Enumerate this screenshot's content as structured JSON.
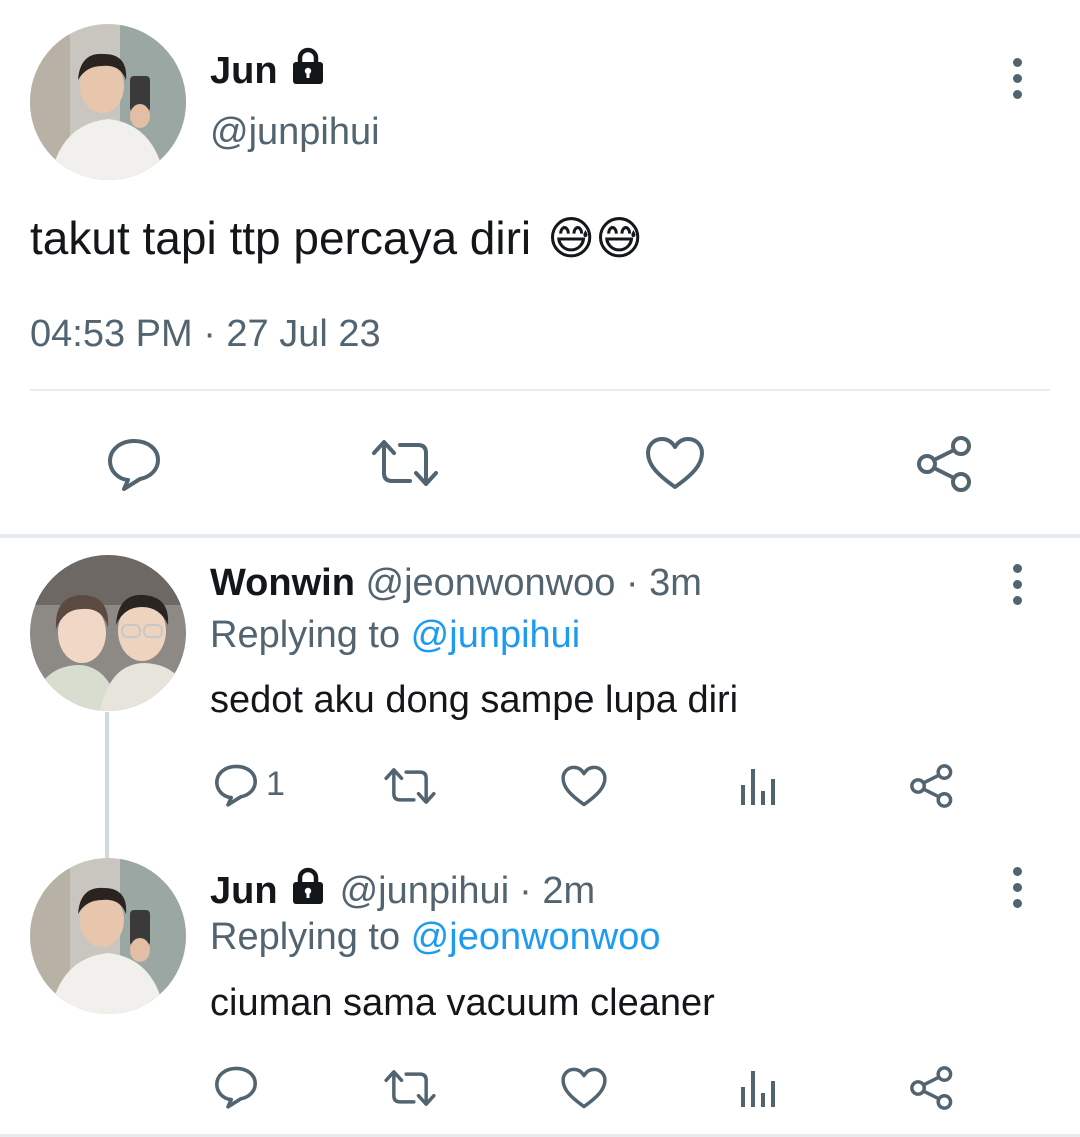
{
  "main_tweet": {
    "name": "Jun",
    "handle": "@junpihui",
    "text": "takut tapi ttp percaya diri",
    "emoji": "😅😅",
    "timestamp": "04:53 PM · 27 Jul 23",
    "icons": [
      "reply-icon",
      "retweet-icon",
      "like-icon",
      "share-icon"
    ]
  },
  "replies": [
    {
      "name": "Wonwin",
      "handle": "@jeonwonwoo",
      "time": "· 3m",
      "replying_label": "Replying to ",
      "replying_to": "@junpihui",
      "text": "sedot aku dong sampe lupa diri",
      "reply_count": "1"
    },
    {
      "name": "Jun",
      "handle": "@junpihui",
      "time": "· 2m",
      "replying_label": "Replying to ",
      "replying_to": "@jeonwonwoo",
      "text": "ciuman sama vacuum cleaner",
      "reply_count": ""
    }
  ],
  "colors": {
    "text": "#14171a",
    "secondary": "#536471",
    "link": "#1d9bf0",
    "divider": "#e6ecf0"
  }
}
